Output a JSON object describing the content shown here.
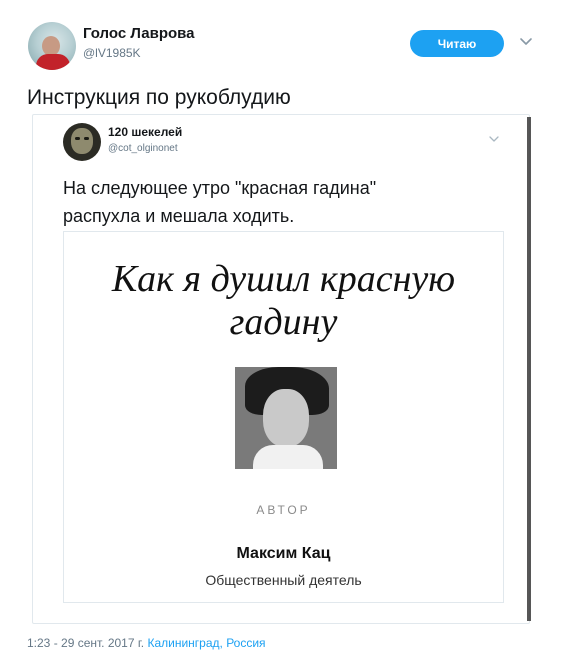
{
  "tweet": {
    "author_name": "Голос Лаврова",
    "author_handle": "@lV1985K",
    "follow_label": "Читаю",
    "text": "Инструкция по рукоблудию",
    "timestamp": "1:23 - 29 сент. 2017 г.",
    "location": "Калининград, Россия"
  },
  "quoted": {
    "author_name": "120 шекелей",
    "author_handle": "@cot_olginonet",
    "text_line1": "На следующее утро \"красная гадина\"",
    "text_line2": "распухла и мешала ходить.",
    "card": {
      "title_line1": "Как я душил красную",
      "title_line2": "гадину",
      "author_label": "АВТОР",
      "author_name": "Максим Кац",
      "author_role": "Общественный деятель"
    }
  },
  "icons": {
    "caret": "chevron-down-icon"
  },
  "colors": {
    "accent": "#1da1f2",
    "text": "#14171a",
    "muted": "#657786"
  }
}
